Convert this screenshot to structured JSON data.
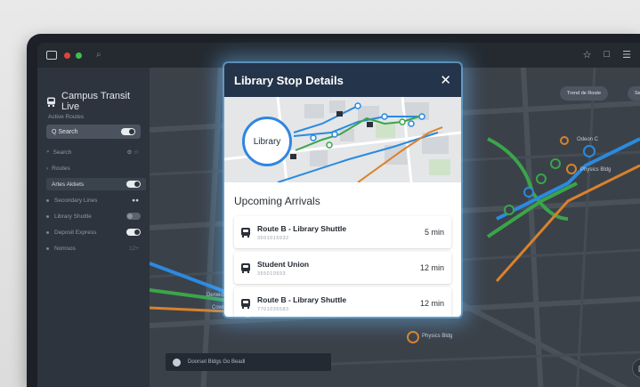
{
  "app": {
    "title": "Campus Transit Live"
  },
  "sidebar": {
    "section_label": "Active Routes",
    "search_label": "Q Search",
    "subheader": "Search",
    "group_label": "Routes",
    "items": [
      {
        "label": "Artes Aktiets",
        "toggle": "on",
        "active": true
      },
      {
        "label": "Secondary Lines",
        "toggle": "dots"
      },
      {
        "label": "Library Shuttle",
        "toggle": "off"
      },
      {
        "label": "Deposit Express",
        "toggle": "on"
      },
      {
        "label": "Nomsos",
        "toggle": "count",
        "count": "12+"
      }
    ]
  },
  "map": {
    "buttons": [
      {
        "label": "Trend de Route"
      },
      {
        "label": "See"
      }
    ],
    "labels": {
      "top_right": "Odeon C",
      "right": "Physics Bldg",
      "left": "Derwick",
      "left2": "Cowley",
      "bottom": "Physics Bldg"
    },
    "bottom_search": "Doorset Bldgs Go Beadl",
    "colors": {
      "blue": "#2a8ae0",
      "green": "#3aa54a",
      "orange": "#d9822b"
    }
  },
  "modal": {
    "title": "Library Stop Details",
    "close_icon": "close-icon",
    "stop_label": "Library",
    "arrivals_title": "Upcoming Arrivals",
    "arrivals": [
      {
        "route": "Route B - Library Shuttle",
        "code": "3501015932",
        "time": "5 min"
      },
      {
        "route": "Student Union",
        "code": "355010593",
        "time": "12 min"
      },
      {
        "route": "Route B - Library Shuttle",
        "code": "7701035583",
        "time": "12 min"
      }
    ]
  }
}
